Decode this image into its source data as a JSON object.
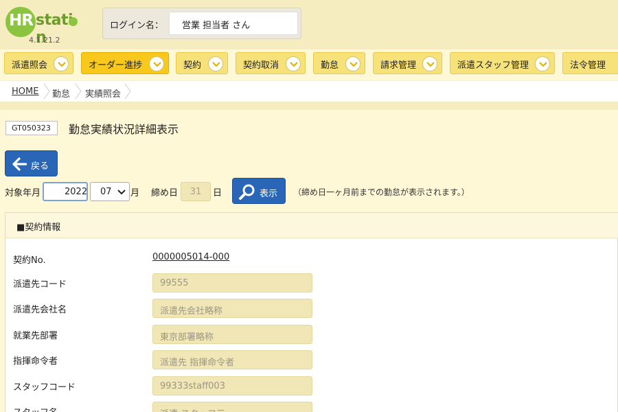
{
  "header": {
    "logo": {
      "hr": "HR",
      "station_a": "stati",
      "station_b": "n",
      "version": "4.1.21.2"
    },
    "login_label": "ログイン名：",
    "login_user": "営業 担当者 さん"
  },
  "nav": {
    "items": [
      {
        "label": "派遣照会"
      },
      {
        "label": "オーダー進捗"
      },
      {
        "label": "契約"
      },
      {
        "label": "契約取消"
      },
      {
        "label": "勤怠"
      },
      {
        "label": "請求管理"
      },
      {
        "label": "派遣スタッフ管理"
      },
      {
        "label": "法令管理"
      }
    ],
    "active_index": 1
  },
  "breadcrumb": [
    "HOME",
    "勤怠",
    "実績照会"
  ],
  "page": {
    "screen_id": "GT050323",
    "title": "勤怠実績状況詳細表示"
  },
  "back_button": {
    "label": "戻る",
    "icon": "arrow-left-icon"
  },
  "filter": {
    "target_label": "対象年月",
    "year": "2022",
    "month": "07",
    "month_suffix": "月",
    "close_label": "締め日",
    "close_day": "31",
    "day_suffix": "日",
    "show_label": "表示",
    "show_icon": "search-icon",
    "hint": "（締め日一ヶ月前までの勤怠が表示されます。）"
  },
  "contract": {
    "section_title": "■契約情報",
    "rows": [
      {
        "label": "契約No.",
        "value": "0000005014-000"
      },
      {
        "label": "派遣先コード",
        "value": "99555"
      },
      {
        "label": "派遣先会社名",
        "value": "派遣先会社略称"
      },
      {
        "label": "就業先部署",
        "value": "東京部署略称"
      },
      {
        "label": "指揮命令者",
        "value": "派遣先 指揮命令者"
      },
      {
        "label": "スタッフコード",
        "value": "99333staff003"
      },
      {
        "label": "スタッフ名",
        "value": "派遣 スタッフ三"
      }
    ]
  },
  "colors": {
    "accent_blue": "#2a66b8",
    "nav_yellow": "#f7e27a",
    "nav_active": "#f8c81d",
    "logo_green": "#8bc53f"
  }
}
